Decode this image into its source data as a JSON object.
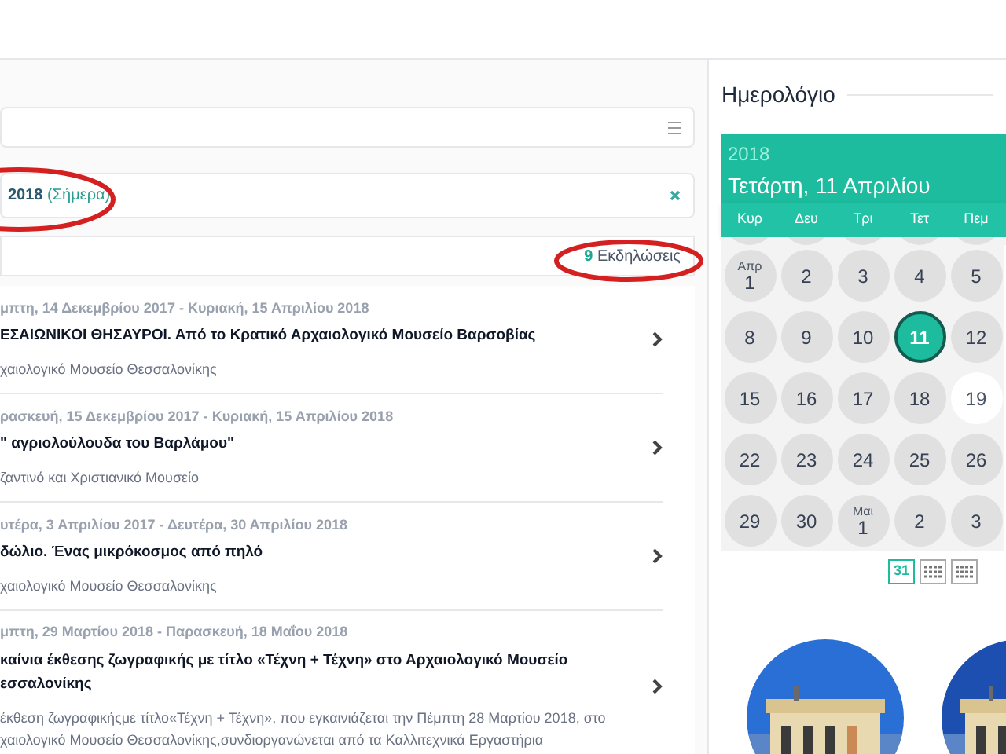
{
  "filters": {
    "date_value": "2018",
    "date_note": "(Σήμερα)",
    "count": "9",
    "count_label": "Εκδηλώσεις"
  },
  "events": [
    {
      "dates": "μπτη, 14 Δεκεμβρίου 2017 - Κυριακή, 15 Απριλίου 2018",
      "title": "ΕΣΑΙΩΝΙΚΟΙ ΘΗΣΑΥΡΟΙ. Από το Κρατικό Αρχαιολογικό Μουσείο Βαρσοβίας",
      "venue": "χαιολογικό Μουσείο Θεσσαλονίκης"
    },
    {
      "dates": "ρασκευή, 15 Δεκεμβρίου 2017 - Κυριακή, 15 Απριλίου 2018",
      "title": "\" αγριολούλουδα του Βαρλάμου\"",
      "venue": "ζαντινό και Χριστιανικό Μουσείο"
    },
    {
      "dates": "υτέρα, 3 Απριλίου 2017 - Δευτέρα, 30 Απριλίου 2018",
      "title": "δώλιο. Ένας μικρόκοσμος από πηλό",
      "venue": "χαιολογικό Μουσείο Θεσσαλονίκης"
    },
    {
      "dates": "μπτη, 29 Μαρτίου 2018 - Παρασκευή, 18 Μαΐου 2018",
      "title": "καίνια έκθεσης ζωγραφικής με τίτλο «Τέχνη + Τέχνη» στο Αρχαιολογικό Μουσείο εσσαλονίκης",
      "venue": "έκθεση ζωγραφικήςμε τίτλο«Τέχνη + Τέχνη», που εγκαινιάζεται την Πέμπτη 28 Μαρτίου 2018, στο χαιολογικό Μουσείο Θεσσαλονίκης,συνδιοργανώνεται από τα Καλλιτεχνικά Εργαστήρια"
    }
  ],
  "calendar": {
    "title": "Ημερολόγιο",
    "year": "2018",
    "date": "Τετάρτη, 11 Απριλίου",
    "weekdays": [
      "Κυρ",
      "Δευ",
      "Τρι",
      "Τετ",
      "Πεμ"
    ],
    "weeks": [
      [
        {
          "day": "1",
          "month": "Απρ",
          "circle": true,
          "selected": false
        },
        {
          "day": "2",
          "circle": true,
          "selected": false
        },
        {
          "day": "3",
          "circle": true,
          "selected": false
        },
        {
          "day": "4",
          "circle": true,
          "selected": false
        },
        {
          "day": "5",
          "circle": true,
          "selected": false
        }
      ],
      [
        {
          "day": "8",
          "circle": true,
          "selected": false
        },
        {
          "day": "9",
          "circle": true,
          "selected": false
        },
        {
          "day": "10",
          "circle": true,
          "selected": false
        },
        {
          "day": "11",
          "circle": true,
          "selected": true
        },
        {
          "day": "12",
          "circle": true,
          "selected": false
        }
      ],
      [
        {
          "day": "15",
          "circle": true,
          "selected": false
        },
        {
          "day": "16",
          "circle": true,
          "selected": false
        },
        {
          "day": "17",
          "circle": true,
          "selected": false
        },
        {
          "day": "18",
          "circle": true,
          "selected": false
        },
        {
          "day": "19",
          "circle": false,
          "selected": false
        }
      ],
      [
        {
          "day": "22",
          "circle": true,
          "selected": false
        },
        {
          "day": "23",
          "circle": true,
          "selected": false
        },
        {
          "day": "24",
          "circle": true,
          "selected": false
        },
        {
          "day": "25",
          "circle": true,
          "selected": false
        },
        {
          "day": "26",
          "circle": true,
          "selected": false
        }
      ],
      [
        {
          "day": "29",
          "circle": true,
          "selected": false
        },
        {
          "day": "30",
          "circle": true,
          "selected": false
        },
        {
          "day": "1",
          "month": "Μαι",
          "circle": true,
          "selected": false
        },
        {
          "day": "2",
          "circle": true,
          "selected": false
        },
        {
          "day": "3",
          "circle": true,
          "selected": false
        }
      ]
    ],
    "view_day": "31"
  }
}
